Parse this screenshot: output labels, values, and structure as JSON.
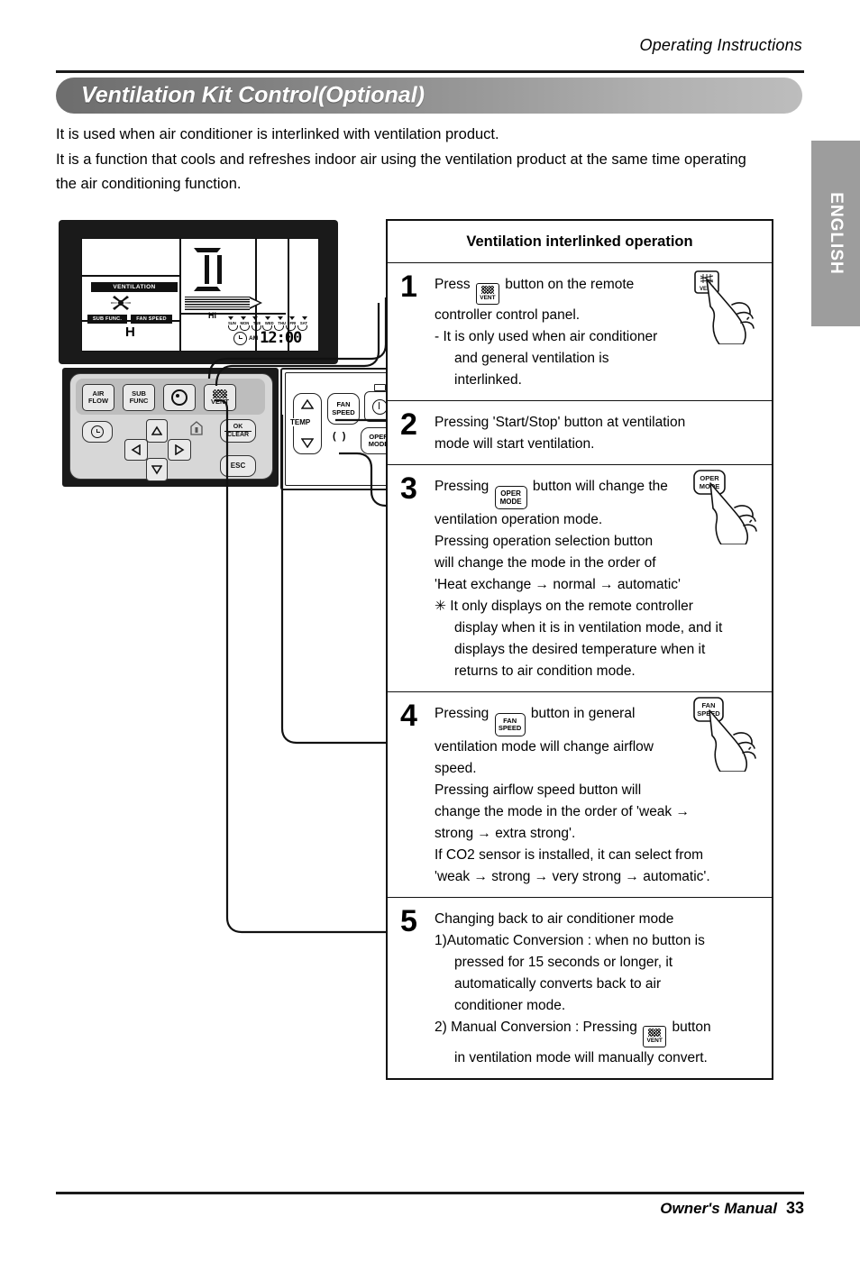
{
  "header": {
    "running_head": "Operating Instructions",
    "banner_title": "Ventilation Kit Control(Optional)",
    "language_tab": "ENGLISH"
  },
  "intro": {
    "line1": "It is used when air conditioner is interlinked with ventilation product.",
    "line2": "It is a function that cools and refreshes indoor air using the ventilation product at the same time operating the air conditioning function."
  },
  "remote": {
    "lcd": {
      "ventilation_label": "VENTILATION",
      "sub_func_label": "SUB FUNC.",
      "fan_speed_label": "FAN SPEED",
      "fan_speed_value": "H",
      "airflow_level": "HI",
      "days": [
        "SUN",
        "MON",
        "TUE",
        "WED",
        "THU",
        "FRI",
        "SAT"
      ],
      "meridiem": "AM",
      "time": "12:00"
    },
    "buttons": {
      "air_flow": "AIR\nFLOW",
      "air_flow_l1": "AIR",
      "air_flow_l2": "FLOW",
      "sub_func_l1": "SUB",
      "sub_func_l2": "FUNC",
      "vent": "VENT",
      "ok_l1": "OK",
      "ok_l2": "CLEAR",
      "esc": "ESC",
      "temp": "TEMP",
      "fan_speed_l1": "FAN",
      "fan_speed_l2": "SPEED",
      "oper_mode_l1": "OPER",
      "oper_mode_l2": "MODE"
    }
  },
  "table": {
    "heading": "Ventilation interlinked operation",
    "steps": [
      {
        "num": "1",
        "lines": [
          {
            "text": "Press ",
            "chip": "vent",
            "after": " button on the remote",
            "indent": 0
          },
          {
            "text": "controller control panel.",
            "indent": 0
          },
          {
            "text": "- It is only used when air conditioner",
            "indent": 1
          },
          {
            "text": "and general ventilation is",
            "indent": 2
          },
          {
            "text": "interlinked.",
            "indent": 2
          }
        ],
        "hand_icon": "vent-button-press-hand"
      },
      {
        "num": "2",
        "lines": [
          {
            "text": "Pressing 'Start/Stop' button at ventilation",
            "indent": 0
          },
          {
            "text": "mode will start ventilation.",
            "indent": 0
          }
        ],
        "hand_icon": null
      },
      {
        "num": "3",
        "lines": [
          {
            "text": "Pressing ",
            "chip": "oper",
            "after": " button will change the",
            "indent": 0
          },
          {
            "text": "ventilation operation mode.",
            "indent": 0
          },
          {
            "text": "Pressing operation selection button",
            "indent": 0
          },
          {
            "text": "will change the mode in the order of",
            "indent": 0
          },
          {
            "text": "'Heat exchange → normal → automatic'",
            "indent": 0
          },
          {
            "text": "✳ It only displays on the remote controller",
            "indent": 0
          },
          {
            "text": "display when it is in ventilation mode, and it",
            "indent": 2
          },
          {
            "text": "displays the desired temperature when it",
            "indent": 2
          },
          {
            "text": "returns to air condition mode.",
            "indent": 2
          }
        ],
        "hand_icon": "oper-mode-button-press-hand"
      },
      {
        "num": "4",
        "lines": [
          {
            "text": "Pressing ",
            "chip": "fanspd",
            "after": " button in general",
            "indent": 0
          },
          {
            "text": "ventilation mode will change airflow",
            "indent": 0
          },
          {
            "text": "speed.",
            "indent": 0
          },
          {
            "text": "Pressing airflow speed button will",
            "indent": 0
          },
          {
            "text": "change the mode in the order of 'weak →",
            "indent": 0
          },
          {
            "text": "strong → extra strong'.",
            "indent": 0
          },
          {
            "text": "If CO2 sensor is installed, it can select from",
            "indent": 0
          },
          {
            "text": "'weak → strong → very strong → automatic'.",
            "indent": 0
          }
        ],
        "hand_icon": "fan-speed-button-press-hand"
      },
      {
        "num": "5",
        "lines": [
          {
            "text": "Changing back to air conditioner mode",
            "indent": 0
          },
          {
            "text": "1)Automatic Conversion : when no button is",
            "indent": 0
          },
          {
            "text": "pressed for 15 seconds or longer, it",
            "indent": 2
          },
          {
            "text": "automatically converts back to air",
            "indent": 2
          },
          {
            "text": "conditioner mode.",
            "indent": 2
          },
          {
            "text": "2) Manual Conversion : Pressing ",
            "chip": "vent",
            "after": " button",
            "indent": 0
          },
          {
            "text": "in ventilation mode will manually convert.",
            "indent": 2
          }
        ],
        "hand_icon": null
      }
    ]
  },
  "footer": {
    "label": "Owner's Manual",
    "page": "33"
  },
  "colors": {
    "banner_dark": "#6d6d6d",
    "banner_light": "#bdbdbd",
    "tab_gray": "#9d9d9d",
    "ink": "#111111",
    "remote_black": "#1a1a1a",
    "keypad_gray": "#d7d7d7"
  }
}
